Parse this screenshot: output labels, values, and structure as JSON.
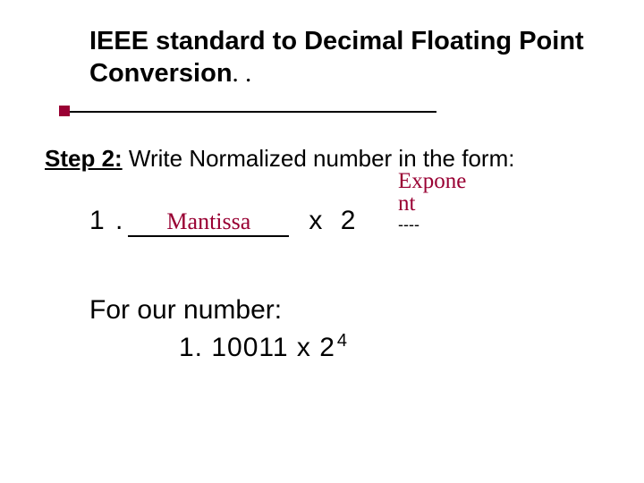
{
  "title": {
    "main": "IEEE standard to Decimal Floating Point Conversion",
    "trail": ". ."
  },
  "step": {
    "label": "Step 2:",
    "text": " Write Normalized number in the form:"
  },
  "formula": {
    "leading": "1 . ",
    "mantissa_label": "Mantissa",
    "times_base": "  x   2 ",
    "exponent_label_line1": "Expone",
    "exponent_label_line2": "nt",
    "exponent_dashes": "----"
  },
  "example": {
    "intro": "For our number:",
    "value_mantissa": "1. 10011  x 2",
    "value_exponent": "4"
  },
  "colors": {
    "accent": "#990033"
  }
}
